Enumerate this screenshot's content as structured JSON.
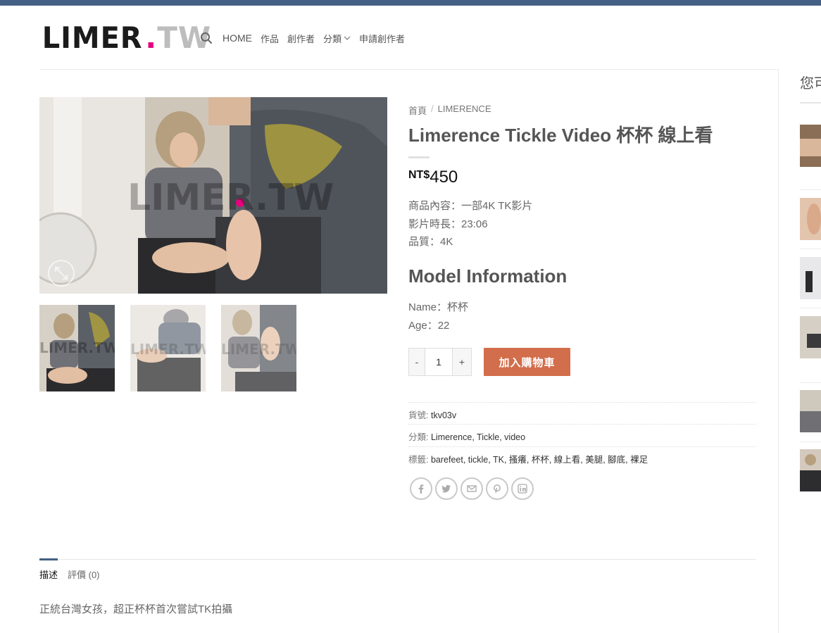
{
  "logo": {
    "part1": "LIMER",
    "dot": ".",
    "part2": "TW"
  },
  "nav": {
    "items": [
      {
        "label": "HOME"
      },
      {
        "label": "作品"
      },
      {
        "label": "創作者"
      },
      {
        "label": "分類"
      },
      {
        "label": "申請創作者"
      }
    ]
  },
  "breadcrumb": {
    "home": "首頁",
    "separator": "/",
    "category": "LIMERENCE"
  },
  "product": {
    "title": "Limerence Tickle Video 杯杯 線上看",
    "currency": "NT$",
    "price": "450",
    "info": [
      "商品內容：一部4K TK影片",
      "影片時長：23:06",
      "品質：4K"
    ],
    "model_heading": "Model Information",
    "model_info": [
      "Name：杯杯",
      "Age：22"
    ],
    "quantity": "1",
    "qty_minus": "-",
    "qty_plus": "+",
    "add_to_cart": "加入購物車"
  },
  "meta": {
    "sku_label": "貨號:",
    "sku": "tkv03v",
    "category_label": "分類:",
    "categories": "Limerence, Tickle, video",
    "tags_label": "標籤:",
    "tags": "barefeet, tickle, TK, 搔癢, 杯杯, 線上看, 美腿, 腳底, 裸足"
  },
  "share_icons": [
    "facebook-icon",
    "twitter-icon",
    "email-icon",
    "pinterest-icon",
    "linkedin-icon"
  ],
  "tabs": {
    "description": "描述",
    "reviews": "評價 (0)"
  },
  "description_text": "正統台灣女孩，超正杯杯首次嘗試TK拍攝",
  "sidebar": {
    "heading": "您可"
  },
  "colors": {
    "topbar": "#446084",
    "accent": "#d26e4b",
    "logo_dot": "#e6007e"
  }
}
